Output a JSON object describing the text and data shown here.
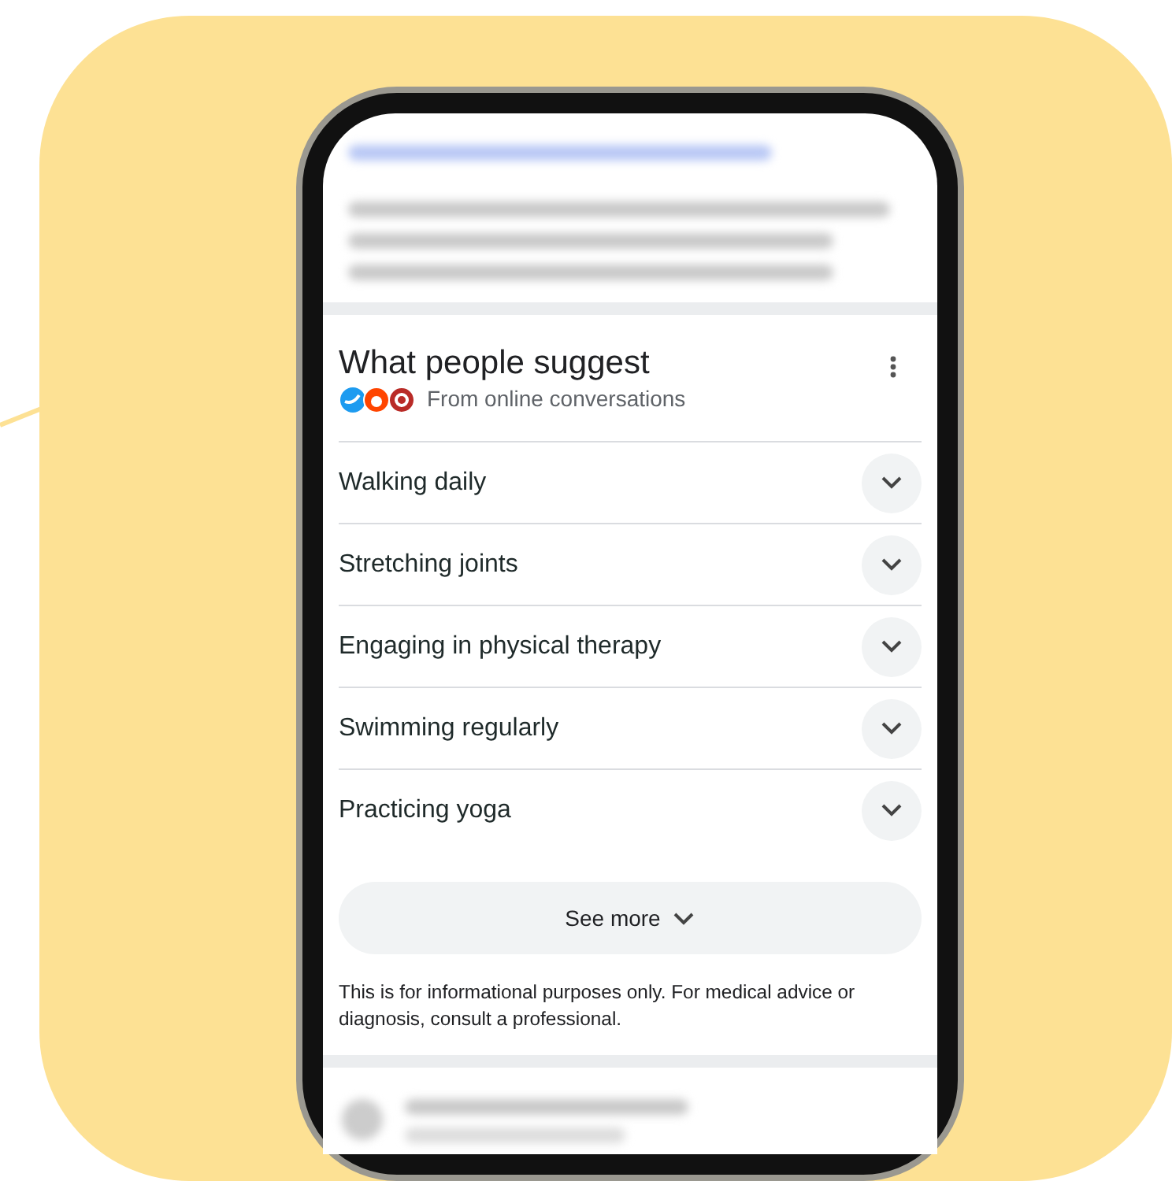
{
  "card": {
    "title": "What people suggest",
    "source": "From online conversations",
    "suggestions": [
      {
        "label": "Walking daily",
        "expanded": false
      },
      {
        "label": "Stretching joints",
        "expanded": false
      },
      {
        "label": "Engaging in physical therapy",
        "expanded": false
      },
      {
        "label": "Swimming regularly",
        "expanded": false
      },
      {
        "label": "Practicing yoga",
        "expanded": false
      }
    ],
    "see_more": "See more",
    "disclaimer": "This is for informational purposes only. For medical advice or diagnosis, consult a professional."
  }
}
